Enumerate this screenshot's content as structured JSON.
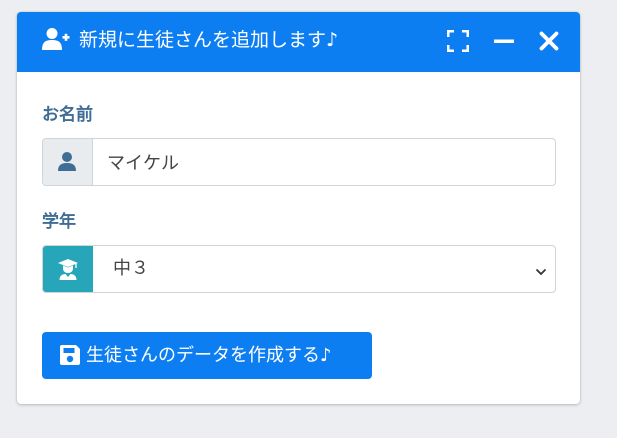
{
  "card": {
    "title": "新規に生徒さんを追加します♪",
    "header_color": "#0d7ef2",
    "icons": {
      "title": "user-plus-icon",
      "maximize": "expand-icon",
      "minimize": "minus-icon",
      "close": "close-icon"
    }
  },
  "form": {
    "name_label": "お名前",
    "name_value": "マイケル",
    "name_icon": "user-icon",
    "grade_label": "学年",
    "grade_value": "中３",
    "grade_icon": "graduate-icon",
    "grade_icon_bg": "#26a6b8",
    "submit_label": "生徒さんのデータを作成する♪",
    "submit_icon": "save-icon"
  },
  "colors": {
    "accent": "#0d7ef2",
    "label": "#3f6d95",
    "page_bg": "#eceef1"
  }
}
